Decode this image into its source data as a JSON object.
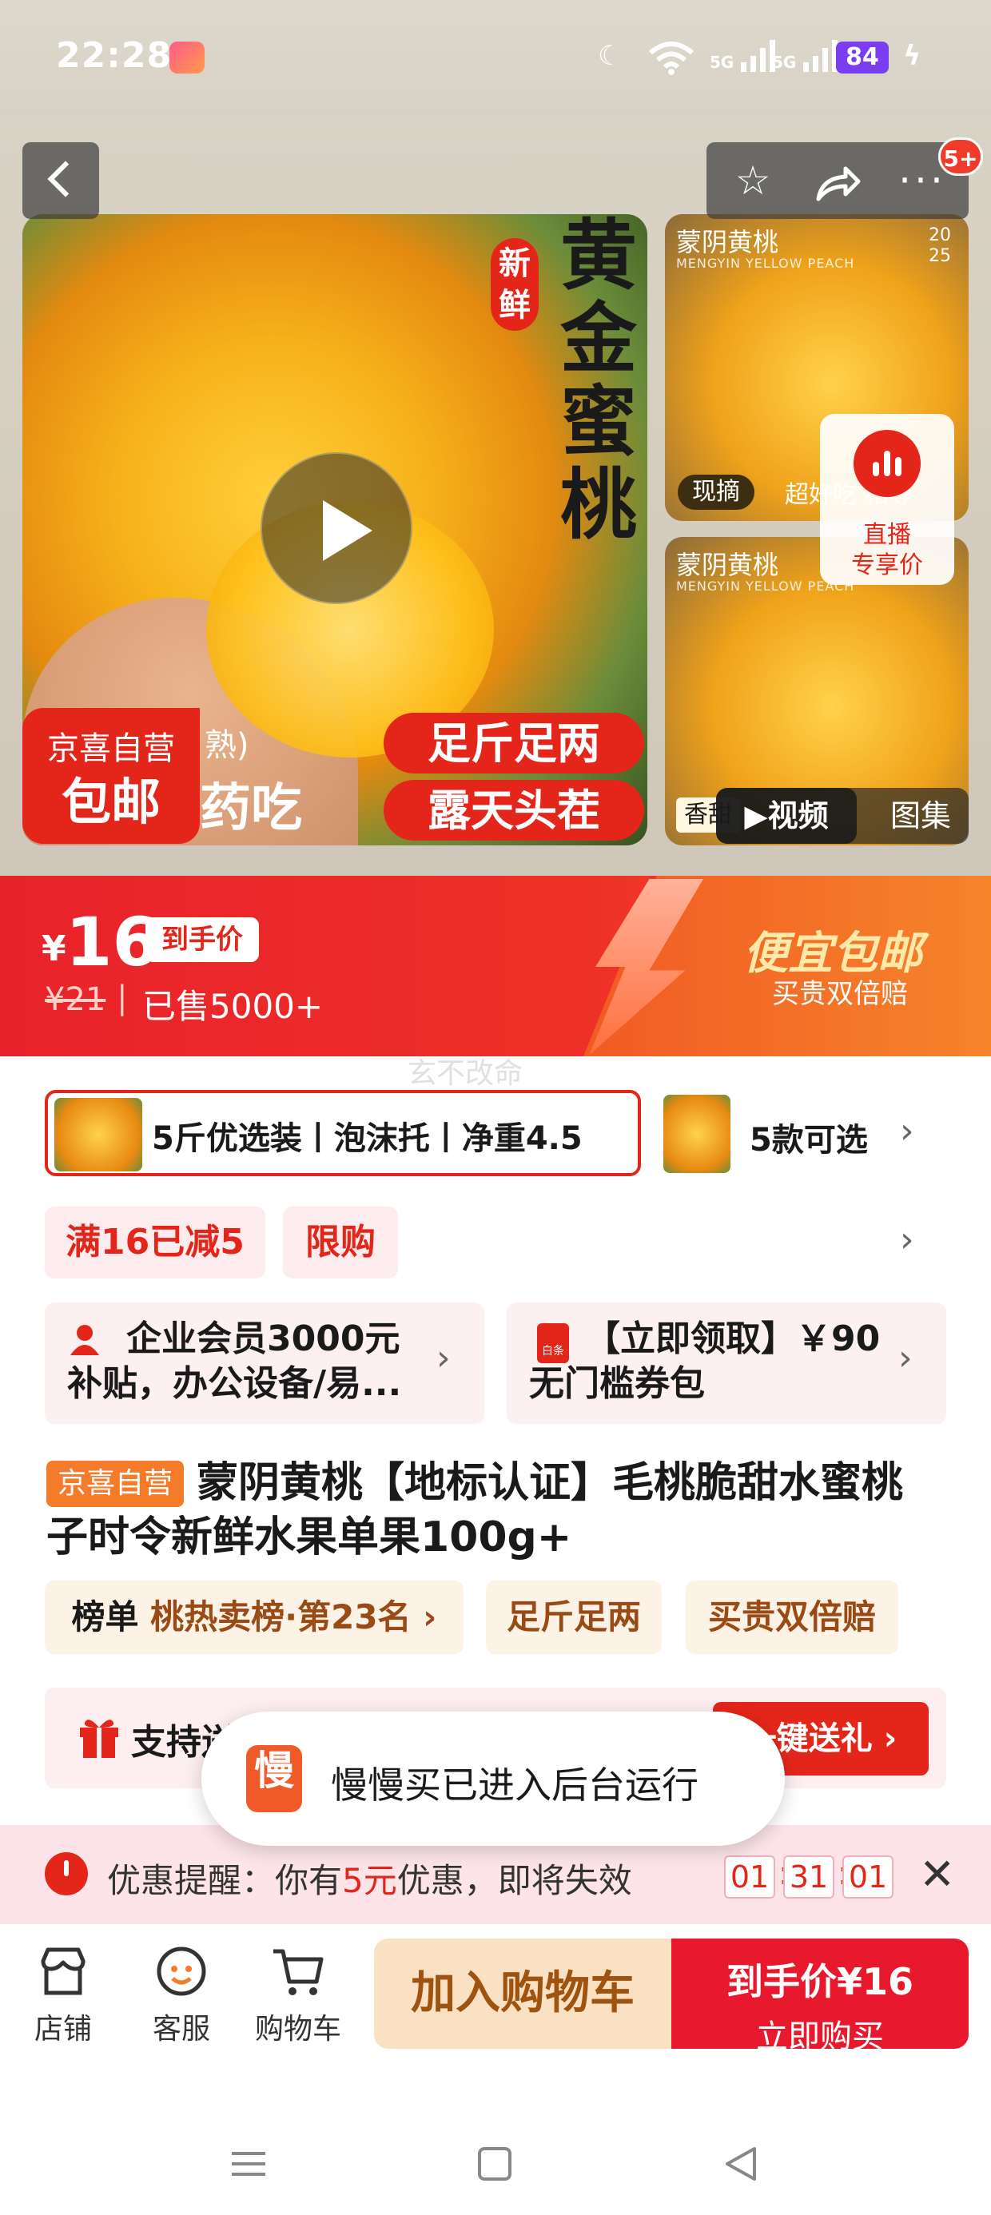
{
  "status_bar": {
    "time": "22:28",
    "signal_1": "5G",
    "signal_2": "5G",
    "battery": "84",
    "icons": [
      "bilibili-app-icon",
      "moon-icon",
      "wifi-icon",
      "signal-icon",
      "signal-icon",
      "battery-icon",
      "charging-icon"
    ]
  },
  "top_actions": {
    "back_icon": "chevron-left-icon",
    "star_icon": "star-icon",
    "share_icon": "share-arrow-icon",
    "more_icon": "more-dots-icon",
    "more_badge": "5+"
  },
  "gallery": {
    "title_new": "新鲜",
    "title_main": "黄金蜜桃",
    "pill_1": "足斤足两",
    "pill_2": "露天头茬",
    "jx_badge_line1": "京喜自营",
    "jx_badge_line2": "包邮",
    "ghost_text_1": "熟)",
    "ghost_text_2": "药吃",
    "thumb_1_title": "蒙阴黄桃",
    "thumb_1_sub": "MENGYIN YELLOW PEACH",
    "thumb_1_year": "20\n25",
    "thumb_1_tag": "现摘",
    "thumb_1_tag2": "超好吃 相等",
    "thumb_2_title": "蒙阴黄桃",
    "thumb_2_sub": "MENGYIN YELLOW PEACH",
    "thumb_2_tag": "香甜",
    "live_line1": "直播",
    "live_line2": "专享价",
    "seg_video": "视频",
    "seg_image": "图集"
  },
  "price": {
    "currency": "¥",
    "amount": "16",
    "tag": "到手价",
    "old_price": "¥21",
    "divider": "|",
    "sold": "已售5000+",
    "promo_title": "便宜包邮",
    "promo_sub": "买贵双倍赔",
    "watermark": "玄不改命"
  },
  "options": {
    "selected_label": "5斤优选装丨泡沫托丨净重4.5",
    "count_label": "5款可选"
  },
  "coupons": {
    "discount": "满16已减5",
    "limit": "限购"
  },
  "cards": {
    "member_text": "企业会员3000元补贴，办公设备/易...",
    "coupon_text": "【立即领取】￥90无门槛券包",
    "coupon_icon_text": "白条"
  },
  "product": {
    "jx_tag": "京喜自营",
    "title": "蒙阴黄桃【地标认证】毛桃脆甜水蜜桃子时令新鲜水果单果100g+"
  },
  "feature_tags": {
    "rank_prefix": "榜单",
    "rank_text": "桃热卖榜·第23名",
    "tag_2": "足斤足两",
    "tag_3": "买贵双倍赔"
  },
  "gift": {
    "label": "支持送",
    "button": "一键送礼"
  },
  "toast": {
    "icon_text": "慢",
    "text": "慢慢买已进入后台运行"
  },
  "reminder": {
    "prefix": "优惠提醒：你有",
    "amount": "5元",
    "suffix": "优惠，即将失效",
    "hh": "01",
    "mm": "31",
    "ss": "01",
    "sep": ":"
  },
  "bottom_nav": {
    "store": "店铺",
    "service": "客服",
    "cart": "购物车",
    "add_cart": "加入购物车",
    "buy_line1": "到手价¥16",
    "buy_line2": "立即购买"
  },
  "colors": {
    "accent_red": "#e4261a",
    "promo_orange": "#f37b2a",
    "cart_bg": "#fbe1c4"
  }
}
